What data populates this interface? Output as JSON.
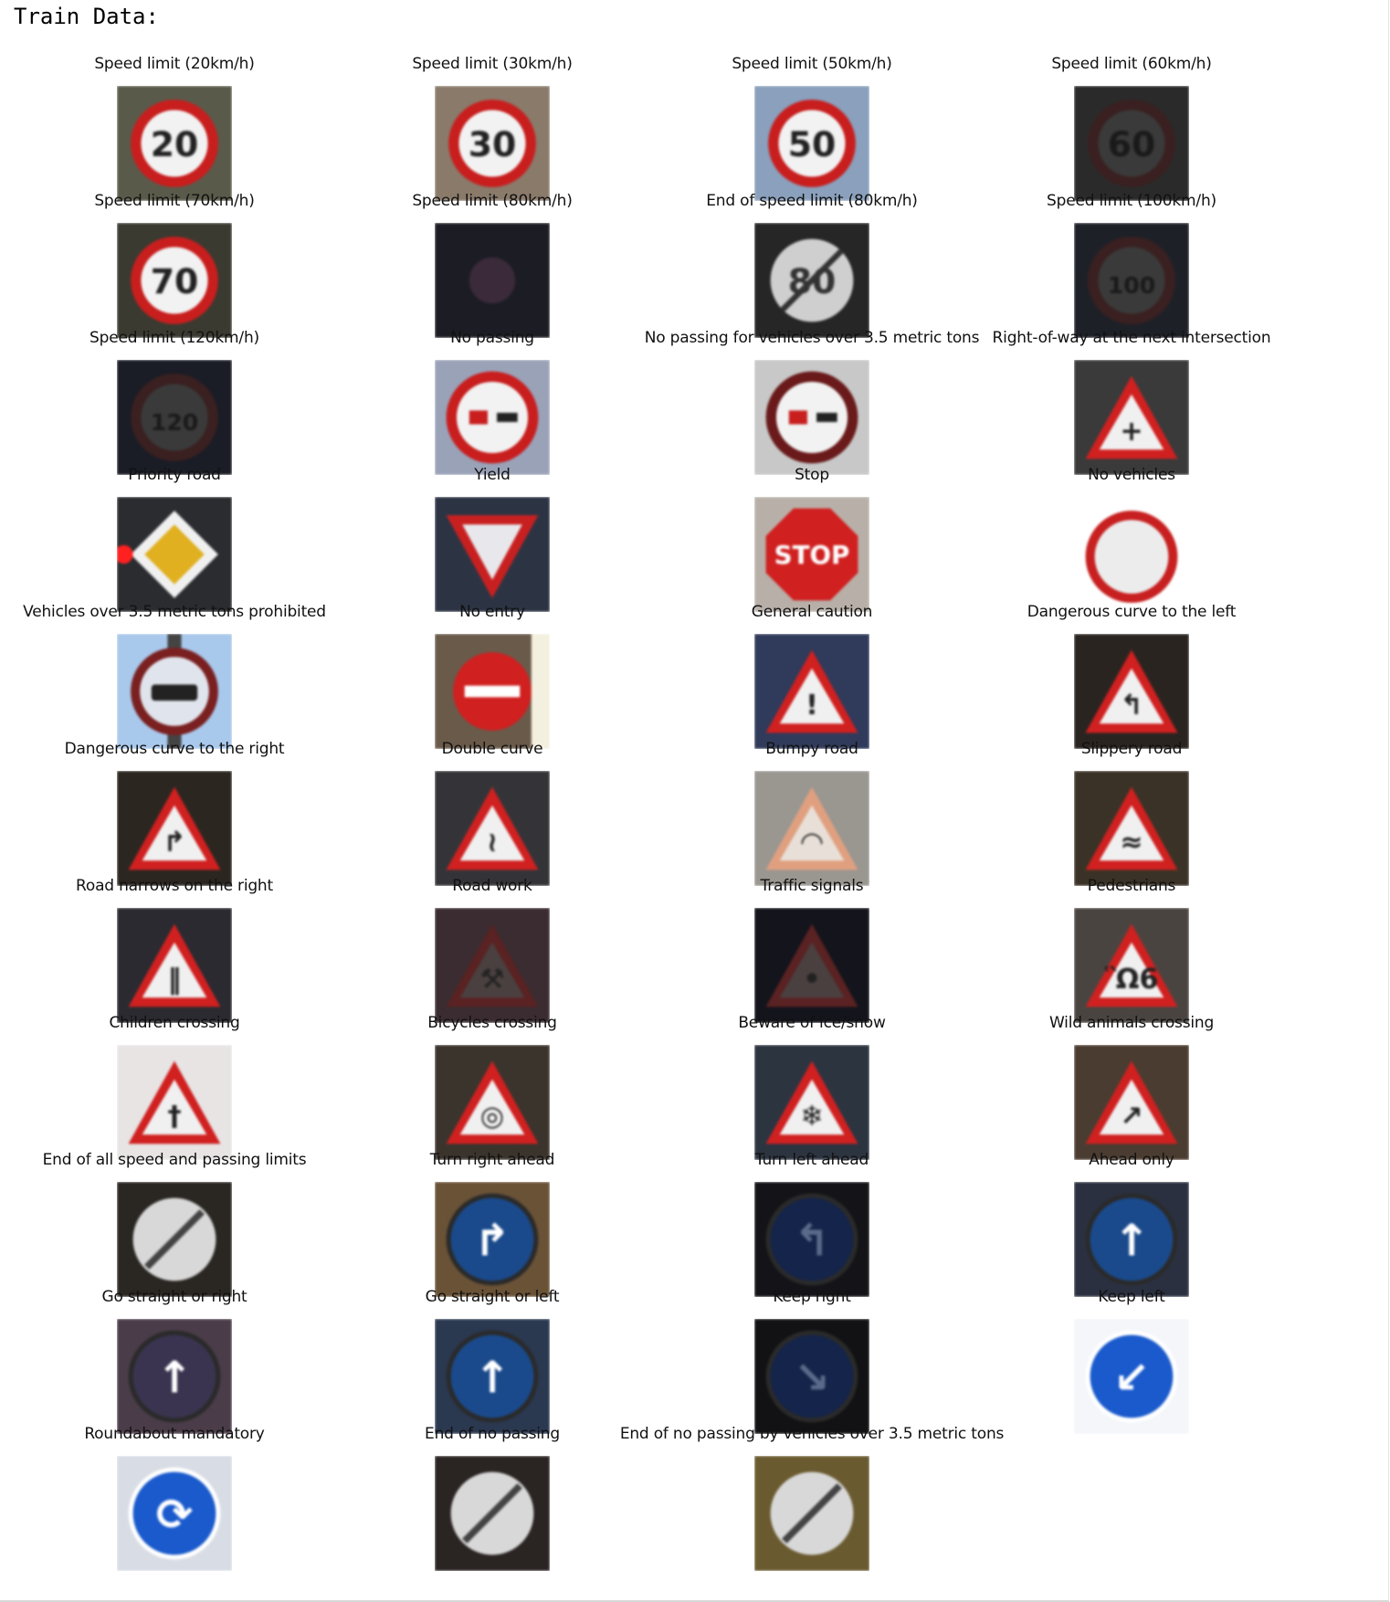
{
  "header": {
    "title": "Train Data:"
  },
  "signs": [
    {
      "label": "Speed limit (20km/h)",
      "icon": "speed-limit-20-sign",
      "type": "speed",
      "text": "20",
      "bg": "#5a5a4a"
    },
    {
      "label": "Speed limit (30km/h)",
      "icon": "speed-limit-30-sign",
      "type": "speed",
      "text": "30",
      "bg": "#8a7a6a"
    },
    {
      "label": "Speed limit (50km/h)",
      "icon": "speed-limit-50-sign",
      "type": "speed",
      "text": "50",
      "bg": "#8aa0bc"
    },
    {
      "label": "Speed limit (60km/h)",
      "icon": "speed-limit-60-sign",
      "type": "speed-dark",
      "text": "60",
      "bg": "#2a2a2a"
    },
    {
      "label": "Speed limit (70km/h)",
      "icon": "speed-limit-70-sign",
      "type": "speed",
      "text": "70",
      "bg": "#3a3a30"
    },
    {
      "label": "Speed limit (80km/h)",
      "icon": "speed-limit-80-sign",
      "type": "dark",
      "text": "",
      "bg": "#1c1c24"
    },
    {
      "label": "End of speed limit (80km/h)",
      "icon": "end-speed-limit-80-sign",
      "type": "end-speed",
      "text": "80",
      "bg": "#262626"
    },
    {
      "label": "Speed limit (100km/h)",
      "icon": "speed-limit-100-sign",
      "type": "speed-dark",
      "text": "100",
      "bg": "#1e2028"
    },
    {
      "label": "Speed limit (120km/h)",
      "icon": "speed-limit-120-sign",
      "type": "speed-dark",
      "text": "120",
      "bg": "#1a1c26"
    },
    {
      "label": "No passing",
      "icon": "no-passing-sign",
      "type": "no-passing",
      "text": "",
      "bg": "#9aa2b8"
    },
    {
      "label": "No passing for vehicles over 3.5 metric tons",
      "icon": "no-passing-trucks-sign",
      "type": "no-passing-truck",
      "text": "",
      "bg": "#c8c8c8"
    },
    {
      "label": "Right-of-way at the next intersection",
      "icon": "right-of-way-sign",
      "type": "triangle",
      "text": "+",
      "bg": "#3a3a3a"
    },
    {
      "label": "Priority road",
      "icon": "priority-road-sign",
      "type": "priority",
      "text": "",
      "bg": "#2a2c30"
    },
    {
      "label": "Yield",
      "icon": "yield-sign",
      "type": "yield",
      "text": "",
      "bg": "#2c3444"
    },
    {
      "label": "Stop",
      "icon": "stop-sign",
      "type": "stop",
      "text": "STOP",
      "bg": "#b8b0a8"
    },
    {
      "label": "No vehicles",
      "icon": "no-vehicles-sign",
      "type": "no-vehicles",
      "text": "",
      "bg": "#ffffff"
    },
    {
      "label": "Vehicles over 3.5 metric tons prohibited",
      "icon": "no-trucks-sign",
      "type": "no-trucks",
      "text": "",
      "bg": "#a8c8ec"
    },
    {
      "label": "No entry",
      "icon": "no-entry-sign",
      "type": "no-entry",
      "text": "",
      "bg": "#6a5a4a"
    },
    {
      "label": "General caution",
      "icon": "general-caution-sign",
      "type": "triangle",
      "text": "!",
      "bg": "#303a5a"
    },
    {
      "label": "Dangerous curve to the left",
      "icon": "curve-left-sign",
      "type": "triangle",
      "text": "↰",
      "bg": "#2a2420"
    },
    {
      "label": "Dangerous curve to the right",
      "icon": "curve-right-sign",
      "type": "triangle",
      "text": "↱",
      "bg": "#2c2620"
    },
    {
      "label": "Double curve",
      "icon": "double-curve-sign",
      "type": "triangle",
      "text": "≀",
      "bg": "#343438"
    },
    {
      "label": "Bumpy road",
      "icon": "bumpy-road-sign",
      "type": "triangle-faded",
      "text": "◠",
      "bg": "#9a9690"
    },
    {
      "label": "Slippery road",
      "icon": "slippery-road-sign",
      "type": "triangle",
      "text": "≈",
      "bg": "#3a3226"
    },
    {
      "label": "Road narrows on the right",
      "icon": "road-narrows-sign",
      "type": "triangle",
      "text": "‖",
      "bg": "#2a2a30"
    },
    {
      "label": "Road work",
      "icon": "road-work-sign",
      "type": "triangle-dark",
      "text": "⚒",
      "bg": "#3a2c30"
    },
    {
      "label": "Traffic signals",
      "icon": "traffic-signals-sign",
      "type": "triangle-dark",
      "text": "•",
      "bg": "#14141c"
    },
    {
      "label": "Pedestrians",
      "icon": "pedestrians-sign",
      "type": "triangle",
      "text": "Ὣ6",
      "bg": "#4a4440"
    },
    {
      "label": "Children crossing",
      "icon": "children-crossing-sign",
      "type": "triangle",
      "text": "†",
      "bg": "#e8e4e4"
    },
    {
      "label": "Bicycles crossing",
      "icon": "bicycles-crossing-sign",
      "type": "triangle",
      "text": "◎",
      "bg": "#3a342c"
    },
    {
      "label": "Beware of ice/snow",
      "icon": "ice-snow-sign",
      "type": "triangle",
      "text": "❄",
      "bg": "#2c3440"
    },
    {
      "label": "Wild animals crossing",
      "icon": "wild-animals-sign",
      "type": "triangle",
      "text": "↗",
      "bg": "#4a3c30"
    },
    {
      "label": "End of all speed and passing limits",
      "icon": "end-all-limits-sign",
      "type": "end",
      "text": "",
      "bg": "#2a2622"
    },
    {
      "label": "Turn right ahead",
      "icon": "turn-right-sign",
      "type": "blue",
      "text": "↱",
      "bg": "#6a5236"
    },
    {
      "label": "Turn left ahead",
      "icon": "turn-left-sign",
      "type": "blue-dark",
      "text": "↰",
      "bg": "#141418"
    },
    {
      "label": "Ahead only",
      "icon": "ahead-only-sign",
      "type": "blue",
      "text": "↑",
      "bg": "#2a3040"
    },
    {
      "label": "Go straight or right",
      "icon": "straight-or-right-sign",
      "type": "blue-faded",
      "text": "↑",
      "bg": "#4a3c48"
    },
    {
      "label": "Go straight or left",
      "icon": "straight-or-left-sign",
      "type": "blue",
      "text": "↑",
      "bg": "#2a3850"
    },
    {
      "label": "Keep right",
      "icon": "keep-right-sign",
      "type": "blue-dark",
      "text": "↘",
      "bg": "#121214"
    },
    {
      "label": "Keep left",
      "icon": "keep-left-sign",
      "type": "blue-bright",
      "text": "↙",
      "bg": "#f4f6fa"
    },
    {
      "label": "Roundabout mandatory",
      "icon": "roundabout-sign",
      "type": "blue-bright",
      "text": "⟳",
      "bg": "#d8dce4"
    },
    {
      "label": "End of no passing",
      "icon": "end-no-passing-sign",
      "type": "end",
      "text": "",
      "bg": "#2a2422"
    },
    {
      "label": "End of no passing by vehicles over 3.5 metric tons",
      "icon": "end-no-passing-trucks-sign",
      "type": "end",
      "text": "",
      "bg": "#6a5a30"
    }
  ]
}
